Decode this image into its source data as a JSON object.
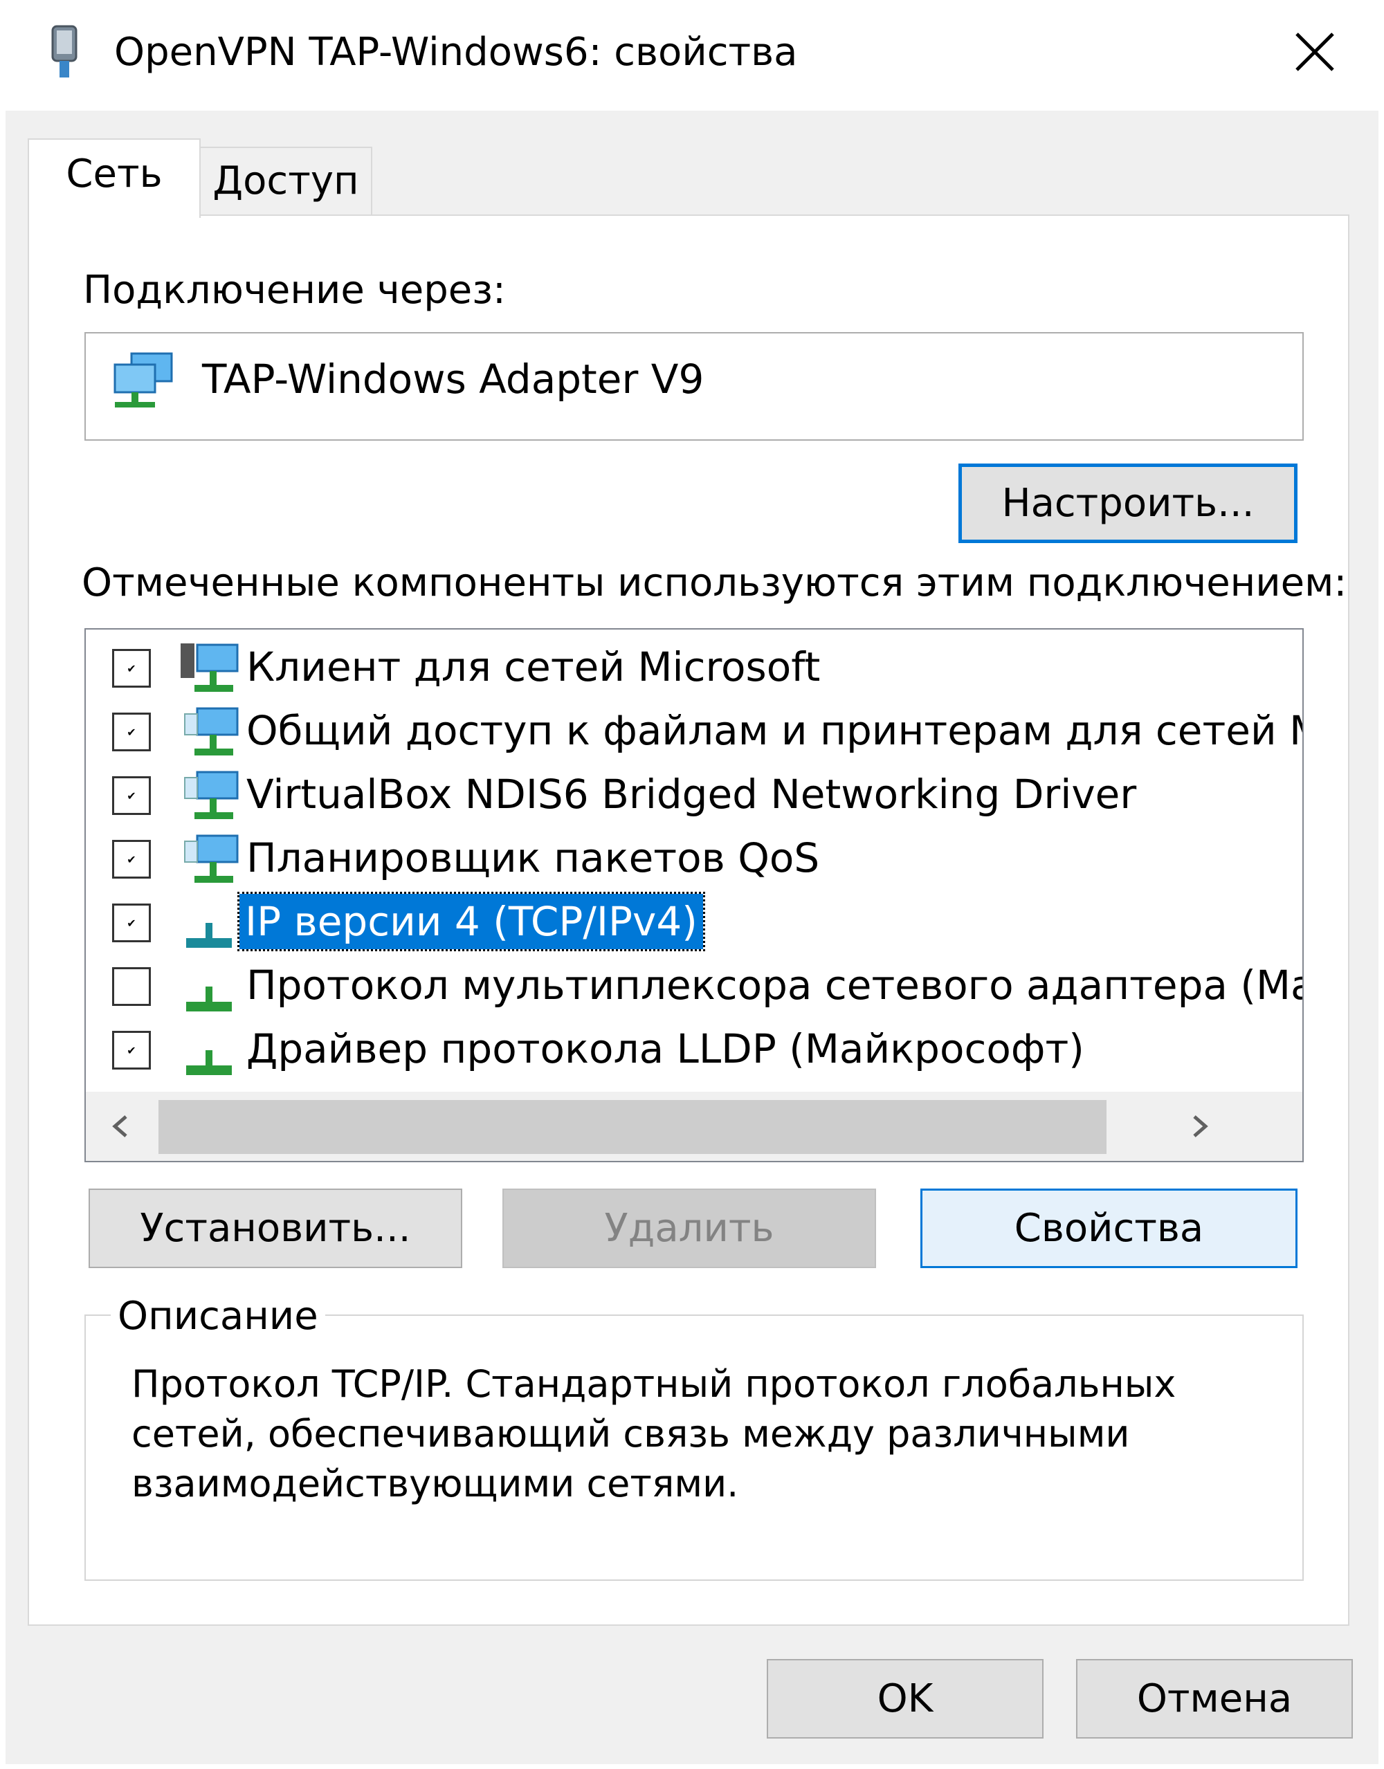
{
  "window": {
    "title": "OpenVPN TAP-Windows6: свойства"
  },
  "tabs": [
    {
      "label": "Сеть",
      "active": true
    },
    {
      "label": "Доступ",
      "active": false
    }
  ],
  "connection": {
    "label": "Подключение через:",
    "adapter_name": "TAP-Windows Adapter V9",
    "configure_label": "Настроить..."
  },
  "components": {
    "label": "Отмеченные компоненты используются этим подключением:",
    "items": [
      {
        "label": "Клиент для сетей Microsoft",
        "checked": true,
        "icon": "network-client-icon"
      },
      {
        "label": "Общий доступ к файлам и принтерам для сетей Mi",
        "checked": true,
        "icon": "network-service-icon"
      },
      {
        "label": "VirtualBox NDIS6 Bridged Networking Driver",
        "checked": true,
        "icon": "network-service-icon"
      },
      {
        "label": "Планировщик пакетов QoS",
        "checked": true,
        "icon": "network-service-icon"
      },
      {
        "label": "IP версии 4 (TCP/IPv4)",
        "checked": true,
        "icon": "protocol-icon",
        "selected": true
      },
      {
        "label": "Протокол мультиплексора сетевого адаптера (Май",
        "checked": false,
        "icon": "protocol-icon"
      },
      {
        "label": "Драйвер протокола LLDP (Майкрософт)",
        "checked": true,
        "icon": "protocol-icon"
      }
    ]
  },
  "actions": {
    "install_label": "Установить...",
    "remove_label": "Удалить",
    "properties_label": "Свойства"
  },
  "description": {
    "legend": "Описание",
    "text": "Протокол TCP/IP. Стандартный протокол глобальных сетей, обеспечивающий связь между различными взаимодействующими сетями."
  },
  "footer": {
    "ok_label": "OK",
    "cancel_label": "Отмена"
  },
  "colors": {
    "accent": "#0078d7",
    "selection": "#0078d7",
    "window_bg": "#f0f0f0"
  }
}
